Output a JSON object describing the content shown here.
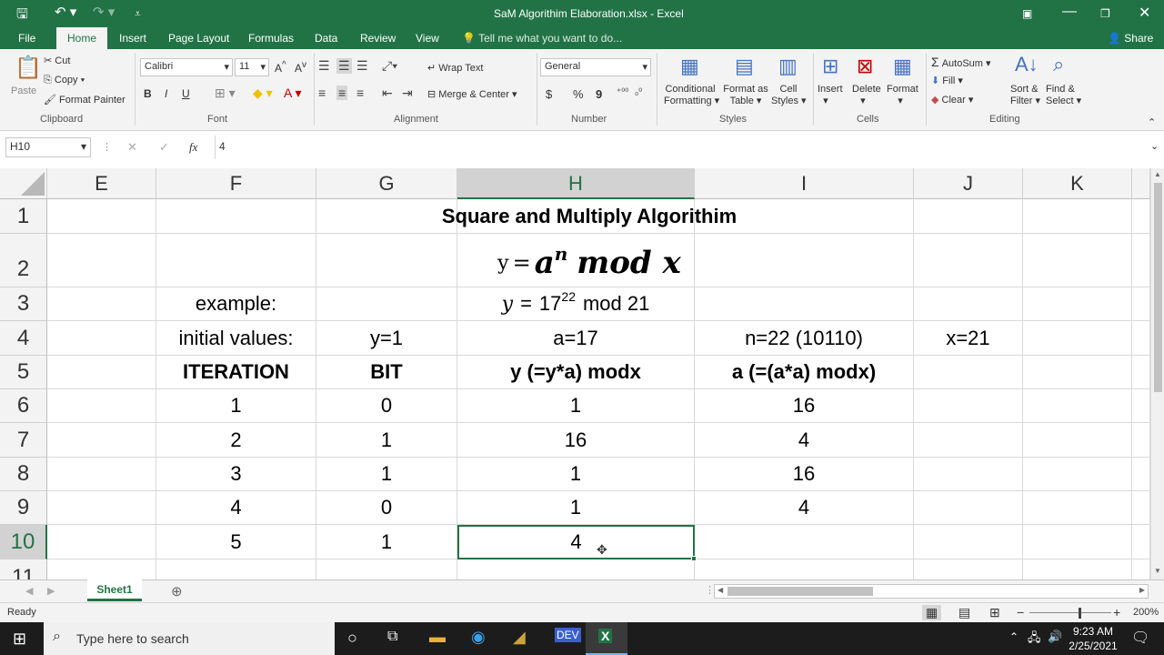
{
  "window": {
    "title": "SaM Algorithim Elaboration.xlsx - Excel",
    "share": "Share",
    "tell_me": "Tell me what you want to do...",
    "accent": "#217346"
  },
  "tabs": [
    "File",
    "Home",
    "Insert",
    "Page Layout",
    "Formulas",
    "Data",
    "Review",
    "View"
  ],
  "ribbon": {
    "clipboard": {
      "paste": "Paste",
      "cut": "Cut",
      "copy": "Copy",
      "format_painter": "Format Painter",
      "label": "Clipboard"
    },
    "font": {
      "name": "Calibri",
      "size": "11",
      "label": "Font",
      "bold": "B",
      "italic": "I",
      "underline": "U"
    },
    "alignment": {
      "wrap": "Wrap Text",
      "merge": "Merge & Center",
      "label": "Alignment"
    },
    "number": {
      "format": "General",
      "label": "Number",
      "currency": "$",
      "percent": "%",
      "comma": "9"
    },
    "styles": {
      "conditional_1": "Conditional",
      "conditional_2": "Formatting",
      "format_as_1": "Format as",
      "format_as_2": "Table",
      "cell_1": "Cell",
      "cell_2": "Styles",
      "label": "Styles"
    },
    "cells": {
      "insert": "Insert",
      "delete": "Delete",
      "format": "Format",
      "label": "Cells"
    },
    "editing": {
      "autosum": "AutoSum",
      "fill": "Fill",
      "clear": "Clear",
      "sort_1": "Sort &",
      "sort_2": "Filter",
      "find_1": "Find &",
      "find_2": "Select",
      "label": "Editing"
    }
  },
  "formula_bar": {
    "name_box": "H10",
    "fx": "fx",
    "value": "4"
  },
  "columns": [
    "E",
    "F",
    "G",
    "H",
    "I",
    "J",
    "K"
  ],
  "selected_column": "H",
  "rows": [
    "1",
    "2",
    "3",
    "4",
    "5",
    "6",
    "7",
    "8",
    "9",
    "10",
    "11"
  ],
  "selected_row": "10",
  "sheet": {
    "title": "Square and Multiply Algorithim",
    "formula_y": "y",
    "formula_eq": "=",
    "formula_a": "a",
    "formula_n": "n",
    "formula_rest": "mod x",
    "example_label": "example:",
    "example_y": "y",
    "example_eq": "=",
    "example_base": "17",
    "example_exp": "22",
    "example_mod": "mod 21",
    "initial_label": "initial values:",
    "init_y": "y=1",
    "init_a": "a=17",
    "init_n": "n=22 (10110)",
    "init_x": "x=21",
    "headers": [
      "ITERATION",
      "BIT",
      "y (=y*a) modx",
      "a (=(a*a) modx)"
    ],
    "table": [
      [
        "1",
        "0",
        "1",
        "16"
      ],
      [
        "2",
        "1",
        "16",
        "4"
      ],
      [
        "3",
        "1",
        "1",
        "16"
      ],
      [
        "4",
        "0",
        "1",
        "4"
      ],
      [
        "5",
        "1",
        "4",
        ""
      ]
    ]
  },
  "sheet_tab": "Sheet1",
  "status": {
    "ready": "Ready",
    "zoom": "200%"
  },
  "taskbar": {
    "search": "Type here to search",
    "time": "9:23 AM",
    "date": "2/25/2021"
  }
}
